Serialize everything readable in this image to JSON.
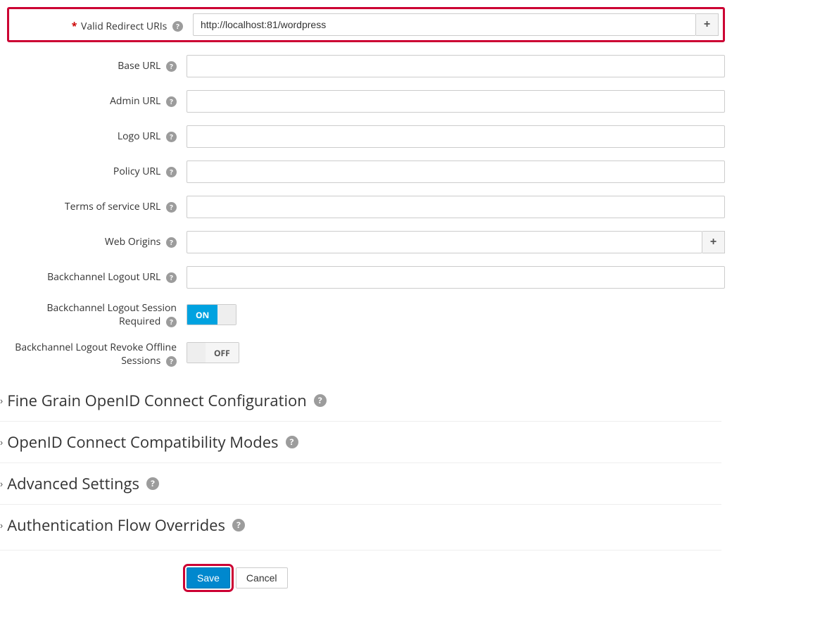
{
  "fields": {
    "valid_redirect_uris": {
      "label": "Valid Redirect URIs",
      "value": "http://localhost:81/wordpress",
      "required": true
    },
    "base_url": {
      "label": "Base URL",
      "value": ""
    },
    "admin_url": {
      "label": "Admin URL",
      "value": ""
    },
    "logo_url": {
      "label": "Logo URL",
      "value": ""
    },
    "policy_url": {
      "label": "Policy URL",
      "value": ""
    },
    "tos_url": {
      "label": "Terms of service URL",
      "value": ""
    },
    "web_origins": {
      "label": "Web Origins",
      "value": ""
    },
    "backchannel_logout_url": {
      "label": "Backchannel Logout URL",
      "value": ""
    },
    "backchannel_logout_session_required": {
      "label": "Backchannel Logout Session Required",
      "state": "ON"
    },
    "backchannel_logout_revoke": {
      "label": "Backchannel Logout Revoke Offline Sessions",
      "state": "OFF"
    }
  },
  "toggle_labels": {
    "on": "ON",
    "off": "OFF"
  },
  "sections": {
    "fine_grain": "Fine Grain OpenID Connect Configuration",
    "compat": "OpenID Connect Compatibility Modes",
    "advanced": "Advanced Settings",
    "auth_flow": "Authentication Flow Overrides"
  },
  "buttons": {
    "save": "Save",
    "cancel": "Cancel"
  }
}
